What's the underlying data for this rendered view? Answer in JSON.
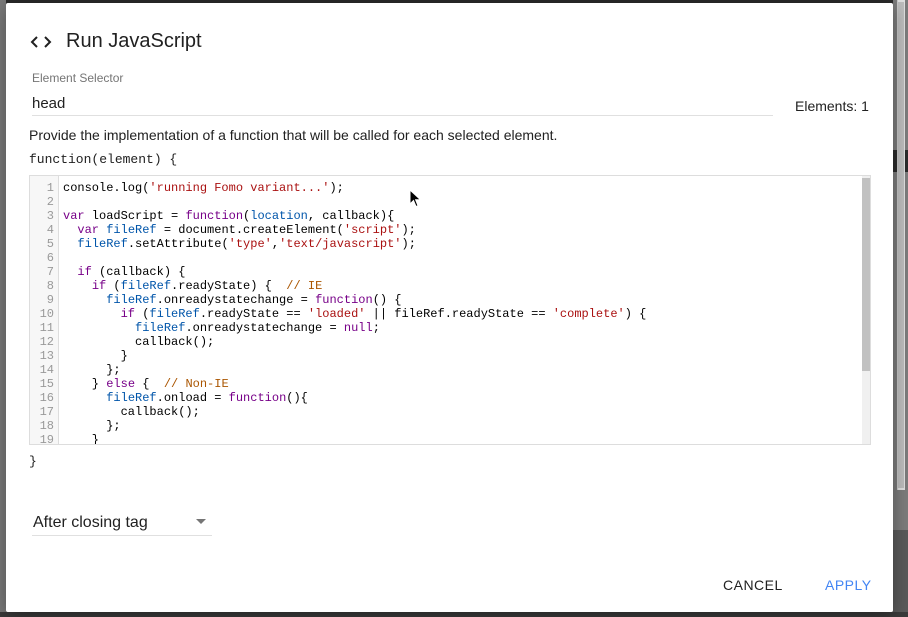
{
  "dialog": {
    "title": "Run JavaScript",
    "title_icon": "code-icon"
  },
  "selector": {
    "label": "Element Selector",
    "value": "head",
    "elements_label": "Elements: 1"
  },
  "description": "Provide the implementation of a function that will be called for each selected element.",
  "function_open": "function(element) {",
  "function_close": "}",
  "editor": {
    "lines": [
      {
        "n": "1",
        "text": "console.log('running Fomo variant...');"
      },
      {
        "n": "2",
        "text": ""
      },
      {
        "n": "3",
        "text": "var loadScript = function(location, callback){"
      },
      {
        "n": "4",
        "text": "  var fileRef = document.createElement('script');"
      },
      {
        "n": "5",
        "text": "  fileRef.setAttribute('type','text/javascript');"
      },
      {
        "n": "6",
        "text": ""
      },
      {
        "n": "7",
        "text": "  if (callback) {"
      },
      {
        "n": "8",
        "text": "    if (fileRef.readyState) {  // IE"
      },
      {
        "n": "9",
        "text": "      fileRef.onreadystatechange = function() {"
      },
      {
        "n": "10",
        "text": "        if (fileRef.readyState == 'loaded' || fileRef.readyState == 'complete') {"
      },
      {
        "n": "11",
        "text": "          fileRef.onreadystatechange = null;"
      },
      {
        "n": "12",
        "text": "          callback();"
      },
      {
        "n": "13",
        "text": "        }"
      },
      {
        "n": "14",
        "text": "      };"
      },
      {
        "n": "15",
        "text": "    } else {  // Non-IE"
      },
      {
        "n": "16",
        "text": "      fileRef.onload = function(){"
      },
      {
        "n": "17",
        "text": "        callback();"
      },
      {
        "n": "18",
        "text": "      };"
      },
      {
        "n": "19",
        "text": "    }"
      }
    ]
  },
  "insert_position": {
    "value": "After closing tag"
  },
  "buttons": {
    "cancel": "CANCEL",
    "apply": "APPLY"
  },
  "colors": {
    "accent": "#4285f4",
    "string": "#aa1111",
    "keyword": "#770088",
    "variable": "#0055aa",
    "comment": "#aa5500"
  }
}
